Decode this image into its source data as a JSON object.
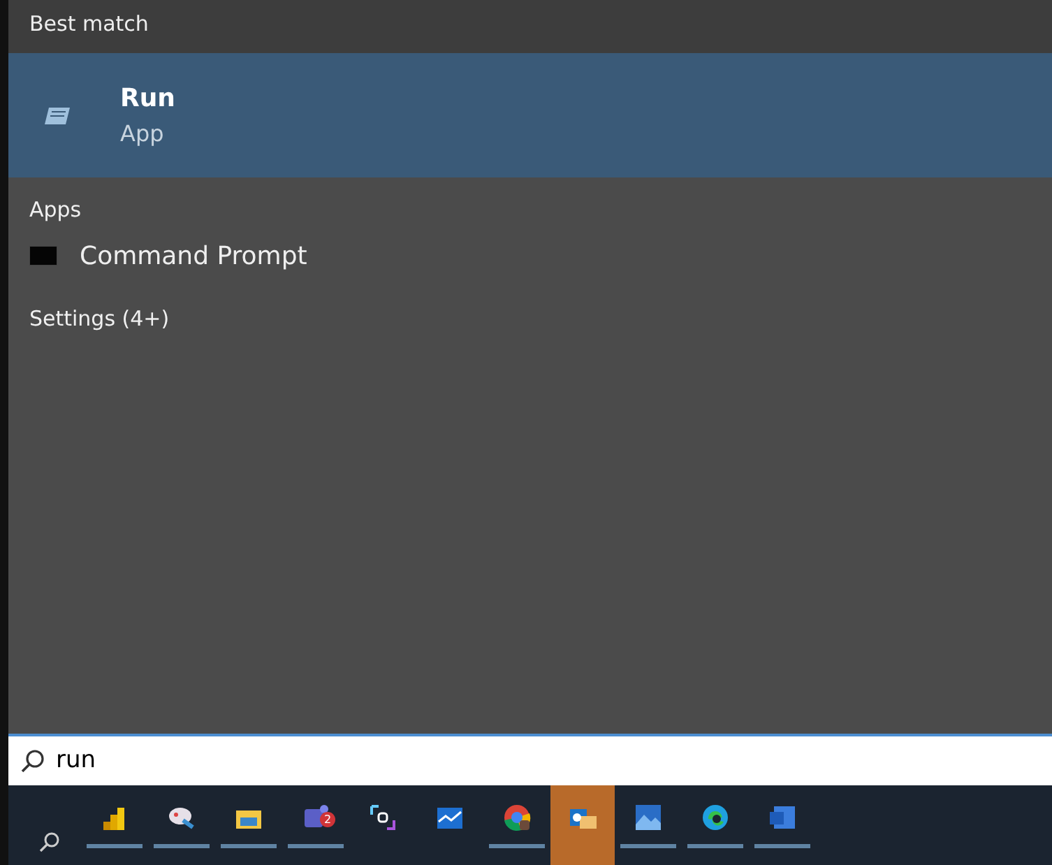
{
  "best_match": {
    "heading": "Best match",
    "item": {
      "title": "Run",
      "subtitle": "App",
      "selected": true
    }
  },
  "sections": [
    {
      "heading": "Apps",
      "items": [
        {
          "label": "Command Prompt"
        }
      ]
    },
    {
      "heading": "Settings (4+)"
    }
  ],
  "search": {
    "value": "run"
  },
  "taskbar": [
    {
      "kind": "bars",
      "running": true,
      "selected": false
    },
    {
      "kind": "palette",
      "running": true,
      "selected": false
    },
    {
      "kind": "folder",
      "running": true,
      "selected": false
    },
    {
      "kind": "chat",
      "running": true,
      "selected": false,
      "badge": "2"
    },
    {
      "kind": "code",
      "running": false,
      "selected": false
    },
    {
      "kind": "chart",
      "running": false,
      "selected": false
    },
    {
      "kind": "browser",
      "running": true,
      "selected": false
    },
    {
      "kind": "mail",
      "running": false,
      "selected": true
    },
    {
      "kind": "photo",
      "running": true,
      "selected": false
    },
    {
      "kind": "edge",
      "running": true,
      "selected": false
    },
    {
      "kind": "document",
      "running": true,
      "selected": false
    }
  ]
}
